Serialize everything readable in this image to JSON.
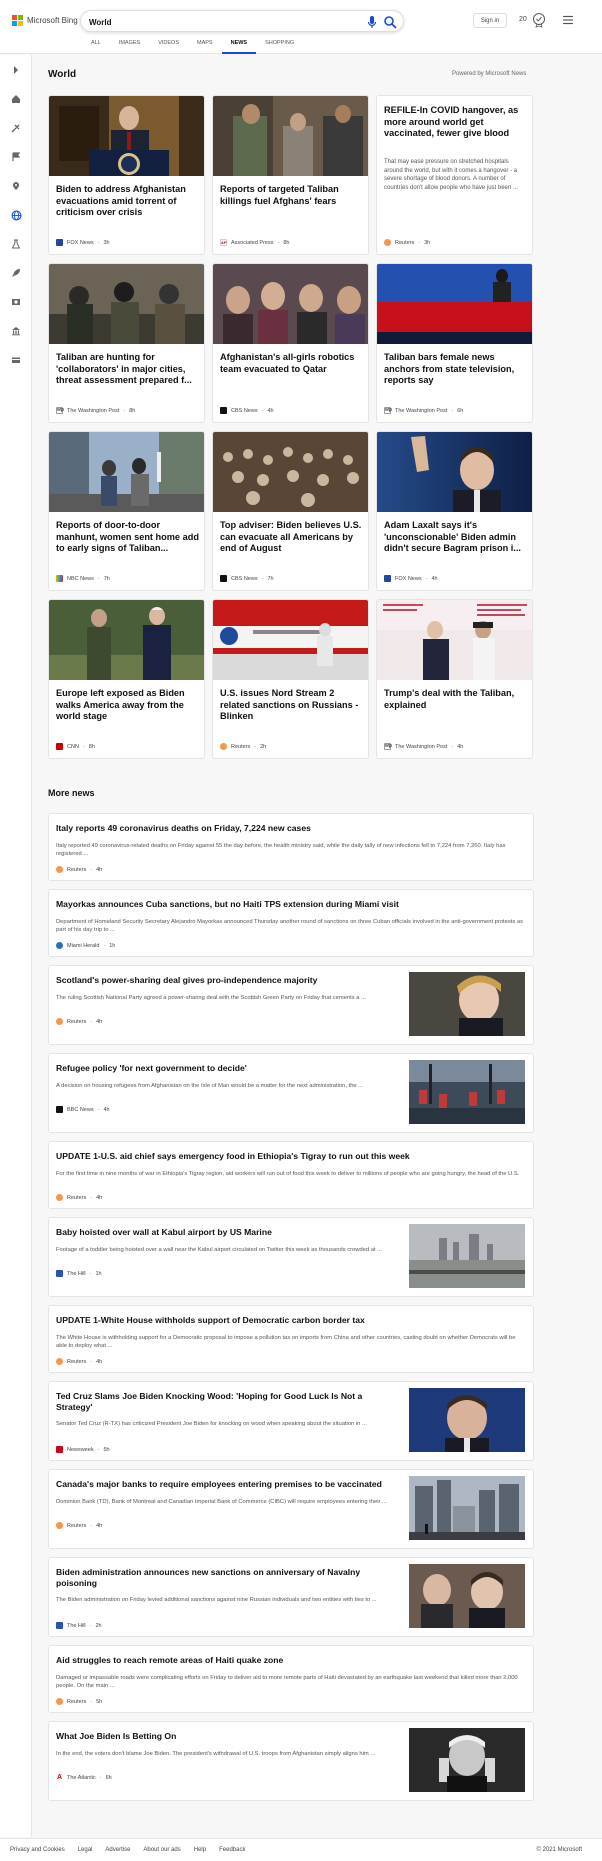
{
  "header": {
    "logo_text": "Microsoft Bing",
    "search_value": "World",
    "signin_label": "Sign in",
    "rewards_count": "20",
    "tabs": [
      {
        "label": "ALL"
      },
      {
        "label": "IMAGES"
      },
      {
        "label": "VIDEOS"
      },
      {
        "label": "MAPS"
      },
      {
        "label": "NEWS",
        "active": true
      },
      {
        "label": "SHOPPING"
      }
    ]
  },
  "rail": {
    "icons": [
      "chevron-right-icon",
      "home-icon",
      "tools-icon",
      "flag-icon",
      "location-pin-icon",
      "globe-icon",
      "science-icon",
      "rocket-icon",
      "film-icon",
      "building-icon",
      "card-icon"
    ]
  },
  "section": {
    "title": "World",
    "powered_by": "Powered by Microsoft News"
  },
  "cards": [
    {
      "title": "Biden to address Afghanistan evacuations amid torrent of criticism over crisis",
      "source": "FOX News",
      "time": "3h"
    },
    {
      "title": "Reports of targeted Taliban killings fuel Afghans' fears",
      "source": "Associated Press",
      "time": "8h"
    },
    {
      "title": "REFILE-In COVID hangover, as more around world get vaccinated, fewer give blood",
      "snippet": "That may ease pressure on stretched hospitals around the world, but with it comes a hangover - a severe shortage of blood donors. A number of countries don't allow people who have just been ...",
      "source": "Reuters",
      "time": "3h"
    },
    {
      "title": "Taliban are hunting for 'collaborators' in major cities, threat assessment prepared f...",
      "source": "The Washington Post",
      "time": "8h"
    },
    {
      "title": "Afghanistan's all-girls robotics team evacuated to Qatar",
      "source": "CBS News",
      "time": "4h"
    },
    {
      "title": "Taliban bars female news anchors from state television, reports say",
      "source": "The Washington Post",
      "time": "6h"
    },
    {
      "title": "Reports of door-to-door manhunt, women sent home add to early signs of Taliban...",
      "source": "NBC News",
      "time": "7h"
    },
    {
      "title": "Top adviser: Biden believes U.S. can evacuate all Americans by end of August",
      "source": "CBS News",
      "time": "7h"
    },
    {
      "title": "Adam Laxalt says it's 'unconscionable' Biden admin didn't secure Bagram prison i...",
      "source": "FOX News",
      "time": "4h"
    },
    {
      "title": "Europe left exposed as Biden walks America away from the world stage",
      "source": "CNN",
      "time": "8h"
    },
    {
      "title": "U.S. issues Nord Stream 2 related sanctions on Russians - Blinken",
      "source": "Reuters",
      "time": "2h"
    },
    {
      "title": "Trump's deal with the Taliban, explained",
      "source": "The Washington Post",
      "time": "4h"
    }
  ],
  "more_news": {
    "title": "More news",
    "items": [
      {
        "title": "Italy reports 49 coronavirus deaths on Friday, 7,224 new cases",
        "snippet": "Italy reported 49 coronavirus-related deaths on Friday against 55 the day before, the health ministry said, while the daily tally of new infections fell to 7,224 from 7,260. Italy has registered ...",
        "source": "Reuters",
        "time": "4h"
      },
      {
        "title": "Mayorkas announces Cuba sanctions, but no Haiti TPS extension during Miami visit",
        "snippet": "Department of Homeland Security Secretary Alejandro Mayorkas announced Thursday another round of sanctions on three Cuban officials involved in the anti-government protests as part of his day trip to ...",
        "source": "Miami Herald",
        "time": "1h"
      },
      {
        "title": "Scotland's power-sharing deal gives pro-independence majority",
        "snippet": "The ruling Scottish National Party agreed a power-sharing deal with the Scottish Green Party on Friday that cements a ...",
        "source": "Reuters",
        "time": "4h"
      },
      {
        "title": "Refugee policy 'for next government to decide'",
        "snippet": "A decision on housing refugees from Afghanistan on the Isle of Man would be a matter for the next administration, the ...",
        "source": "BBC News",
        "time": "4h"
      },
      {
        "title": "UPDATE 1-U.S. aid chief says emergency food in Ethiopia's Tigray to run out this week",
        "snippet": "For the first time in nine months of war in Ethiopia's Tigray region, aid workers will run out of food this week to deliver to millions of people who are going hungry, the head of the U.S.",
        "source": "Reuters",
        "time": "4h"
      },
      {
        "title": "Baby hoisted over wall at Kabul airport by US Marine",
        "snippet": "Footage of a toddler being hoisted over a wall near the Kabul airport circulated on Twitter this week as thousands crowded at ...",
        "source": "The Hill",
        "time": "1h"
      },
      {
        "title": "UPDATE 1-White House withholds support of Democratic carbon border tax",
        "snippet": "The White House is withholding support for a Democratic proposal to impose a pollution tax on imports from China and other countries, casting doubt on whether Democrats will be able to deploy what ...",
        "source": "Reuters",
        "time": "4h"
      },
      {
        "title": "Ted Cruz Slams Joe Biden Knocking Wood: 'Hoping for Good Luck Is Not a Strategy'",
        "snippet": "Senator Ted Cruz (R-TX) has criticized President Joe Biden for knocking on wood when speaking about the situation in ...",
        "source": "Newsweek",
        "time": "5h"
      },
      {
        "title": "Canada's major banks to require employees entering premises to be vaccinated",
        "snippet": "Dominion Bank (TD), Bank of Montreal and Canadian Imperial Bank of Commerce (CIBC) will require employees entering their ...",
        "source": "Reuters",
        "time": "4h"
      },
      {
        "title": "Biden administration announces new sanctions on anniversary of Navalny poisoning",
        "snippet": "The Biden administration on Friday levied additional sanctions against nine Russian individuals and two entities with ties to ...",
        "source": "The Hill",
        "time": "2h"
      },
      {
        "title": "Aid struggles to reach remote areas of Haiti quake zone",
        "snippet": "Damaged or impassable roads were complicating efforts on Friday to deliver aid to more remote parts of Haiti devastated by an earthquake last weekend that killed more than 2,000 people. On the main ...",
        "source": "Reuters",
        "time": "5h"
      },
      {
        "title": "What Joe Biden Is Betting On",
        "snippet": "In the end, the voters don't blame Joe Biden. The president's withdrawal of U.S. troops from Afghanistan simply aligns him ...",
        "source": "The Atlantic",
        "time": "6h"
      }
    ]
  },
  "footer": {
    "links": [
      "Privacy and Cookies",
      "Legal",
      "Advertise",
      "About our ads",
      "Help",
      "Feedback"
    ],
    "copyright": "© 2021 Microsoft"
  },
  "colors": {
    "accent": "#174ae4",
    "reuters": "#f79646",
    "fox": "#1e4a9c",
    "cnn": "#cc0000"
  }
}
